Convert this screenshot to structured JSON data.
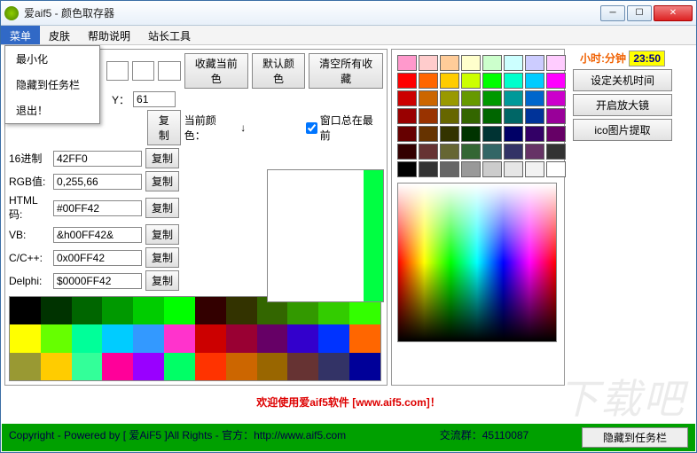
{
  "window": {
    "title": "爱aif5 - 颜色取存器"
  },
  "menubar": [
    "菜单",
    "皮肤",
    "帮助说明",
    "站长工具"
  ],
  "dropdown": [
    "最小化",
    "隐藏到任务栏",
    "退出！"
  ],
  "toolbar": {
    "fav_current": "收藏当前色",
    "default_color": "默认颜色",
    "clear_all": "清空所有收藏"
  },
  "coords": {
    "y_label": "Y：",
    "y_value": "61",
    "copy": "复制",
    "current_label": "当前颜色：",
    "arrow": "↓",
    "always_top": "窗口总在最前"
  },
  "fields": [
    {
      "label": "16进制",
      "value": "42FF0",
      "btn": "复制"
    },
    {
      "label": "RGB值:",
      "value": "0,255,66",
      "btn": "复制"
    },
    {
      "label": "HTML码:",
      "value": "#00FF42",
      "btn": "复制"
    },
    {
      "label": "VB:",
      "value": "&h00FF42&",
      "btn": "复制"
    },
    {
      "label": "C/C++:",
      "value": "0x00FF42",
      "btn": "复制"
    },
    {
      "label": "Delphi:",
      "value": "$0000FF42",
      "btn": "复制"
    }
  ],
  "fav_colors": [
    "#000000",
    "#003300",
    "#006600",
    "#009900",
    "#00cc00",
    "#00ff00",
    "#330000",
    "#333300",
    "#336600",
    "#339900",
    "#33cc00",
    "#33ff00",
    "#ffff00",
    "#66ff00",
    "#00ff99",
    "#00ccff",
    "#3399ff",
    "#ff33cc",
    "#cc0000",
    "#990033",
    "#660066",
    "#3300cc",
    "#0033ff",
    "#ff6600",
    "#999933",
    "#ffcc00",
    "#33ff99",
    "#ff0099",
    "#9900ff",
    "#00ff66",
    "#ff3300",
    "#cc6600",
    "#996600",
    "#663333",
    "#333366",
    "#000099"
  ],
  "palette": [
    "#ff99cc",
    "#ffcccc",
    "#ffcc99",
    "#ffffcc",
    "#ccffcc",
    "#ccffff",
    "#ccccff",
    "#ffccff",
    "#ff0000",
    "#ff6600",
    "#ffcc00",
    "#ccff00",
    "#00ff00",
    "#00ffcc",
    "#00ccff",
    "#ff00ff",
    "#cc0000",
    "#cc6600",
    "#999900",
    "#669900",
    "#009900",
    "#009999",
    "#0066cc",
    "#cc00cc",
    "#990000",
    "#993300",
    "#666600",
    "#336600",
    "#006600",
    "#006666",
    "#003399",
    "#990099",
    "#660000",
    "#663300",
    "#333300",
    "#003300",
    "#003333",
    "#000066",
    "#330066",
    "#660066",
    "#330000",
    "#663333",
    "#666633",
    "#336633",
    "#336666",
    "#333366",
    "#663366",
    "#333333",
    "#000000",
    "#333333",
    "#666666",
    "#999999",
    "#cccccc",
    "#e6e6e6",
    "#f2f2f2",
    "#ffffff"
  ],
  "clock": {
    "label": "小时:分钟",
    "time": "23:50"
  },
  "rightbtns": [
    "设定关机时间",
    "开启放大镜",
    "ico图片提取"
  ],
  "footer": {
    "welcome": "欢迎使用爱aif5软件 [www.aif5.com]！",
    "copyright": "Copyright - Powered by [ 爱AiF5 ]All Rights - 官方：http://www.aif5.com",
    "group": "交流群：45110087",
    "hide": "隐藏到任务栏"
  },
  "watermark": "下载吧"
}
